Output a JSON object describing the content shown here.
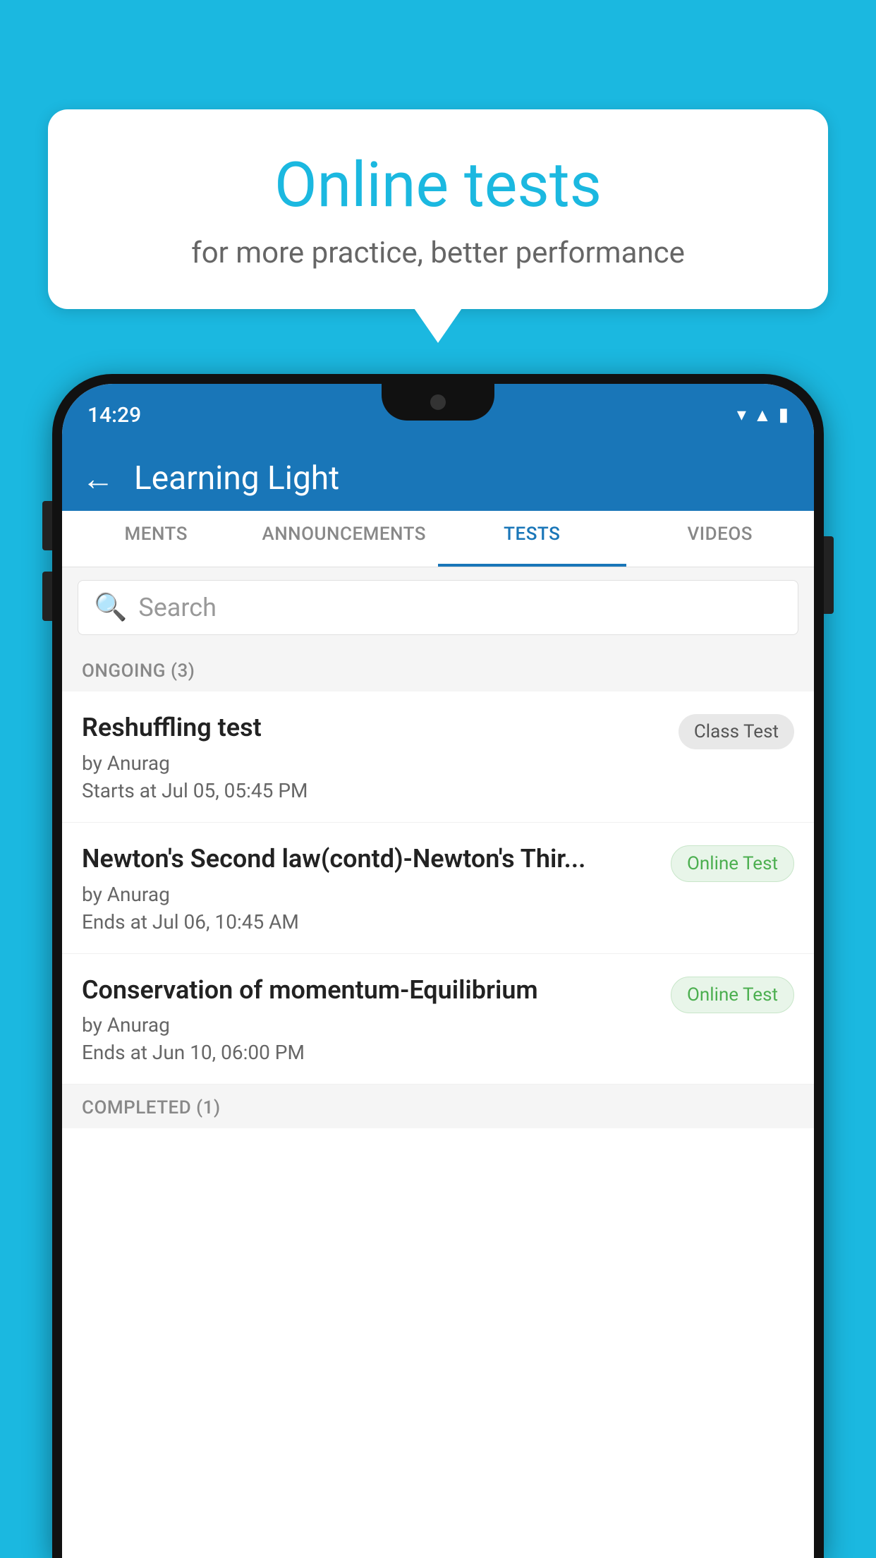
{
  "background_color": "#1bb8e0",
  "bubble": {
    "title": "Online tests",
    "subtitle": "for more practice, better performance"
  },
  "phone": {
    "status_bar": {
      "time": "14:29",
      "wifi": "▾",
      "signal": "▲",
      "battery": "▮"
    },
    "header": {
      "title": "Learning Light",
      "back_label": "←"
    },
    "tabs": [
      {
        "label": "MENTS",
        "active": false
      },
      {
        "label": "ANNOUNCEMENTS",
        "active": false
      },
      {
        "label": "TESTS",
        "active": true
      },
      {
        "label": "VIDEOS",
        "active": false
      }
    ],
    "search": {
      "placeholder": "Search"
    },
    "sections": [
      {
        "label": "ONGOING (3)",
        "items": [
          {
            "name": "Reshuffling test",
            "author": "by Anurag",
            "time": "Starts at  Jul 05, 05:45 PM",
            "badge": "Class Test",
            "badge_type": "class"
          },
          {
            "name": "Newton's Second law(contd)-Newton's Thir...",
            "author": "by Anurag",
            "time": "Ends at  Jul 06, 10:45 AM",
            "badge": "Online Test",
            "badge_type": "online"
          },
          {
            "name": "Conservation of momentum-Equilibrium",
            "author": "by Anurag",
            "time": "Ends at  Jun 10, 06:00 PM",
            "badge": "Online Test",
            "badge_type": "online"
          }
        ]
      },
      {
        "label": "COMPLETED (1)",
        "items": []
      }
    ]
  }
}
